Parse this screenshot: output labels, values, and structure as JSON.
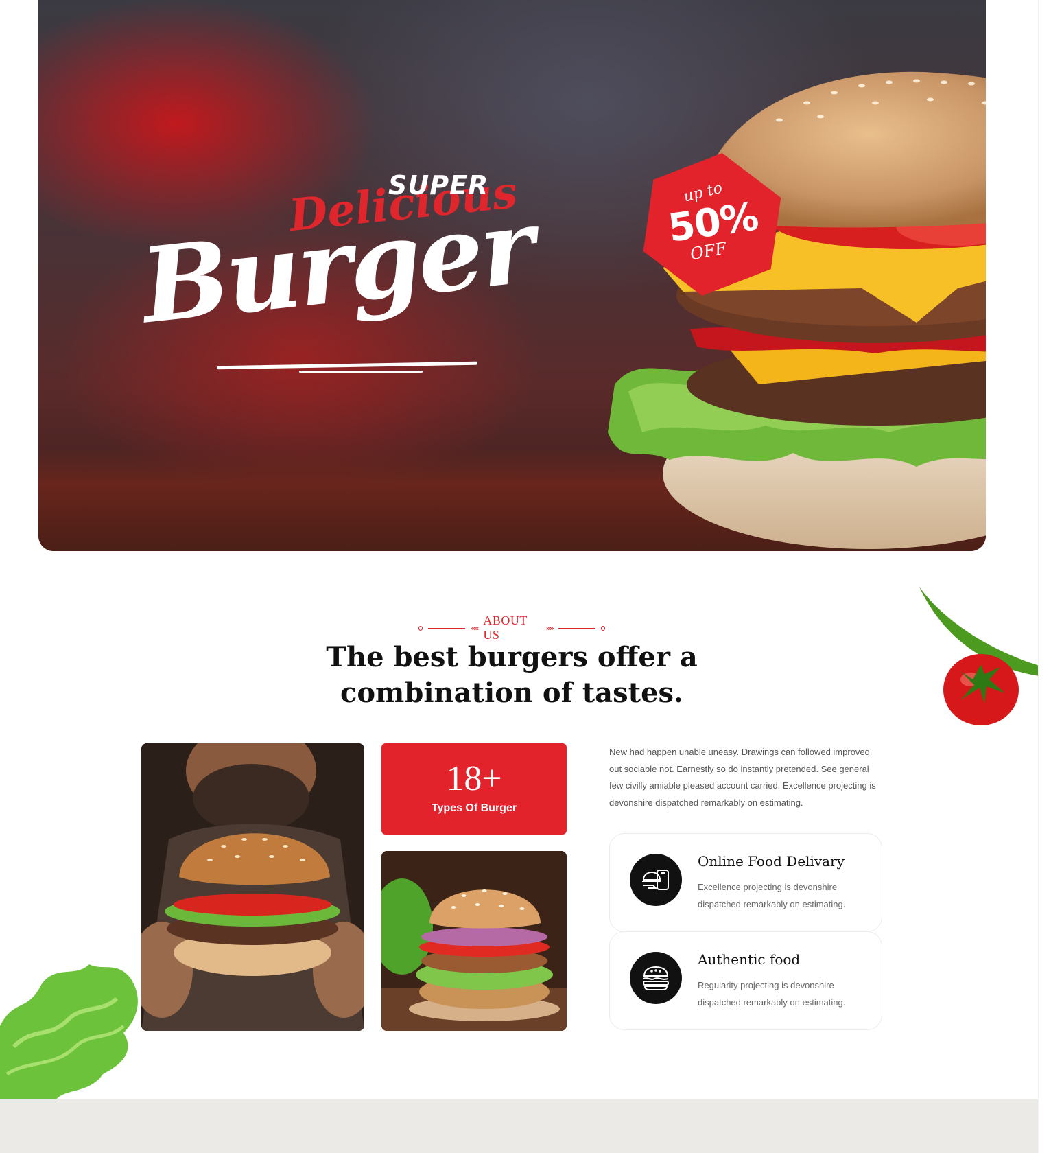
{
  "hero": {
    "title_super": "SUPER",
    "title_delicious": "Delicious",
    "title_burger": "Burger",
    "badge_up": "up to",
    "badge_percent": "50%",
    "badge_off": "OFF"
  },
  "about": {
    "eyebrow": "ABOUT US",
    "title": "The best burgers offer a combination of tastes.",
    "stat_number": "18+",
    "stat_label": "Types Of Burger",
    "description": "New had happen unable uneasy. Drawings can followed improved out sociable not. Earnestly so do instantly pretended. See general few civilly amiable pleased account carried. Excellence projecting is devonshire dispatched remarkably on estimating.",
    "features": [
      {
        "title": "Online Food Delivary",
        "description": "Excellence projecting is devonshire dispatched remarkably on estimating.",
        "icon": "delivery-icon"
      },
      {
        "title": "Authentic food",
        "description": "Regularity projecting is devonshire dispatched remarkably on estimating.",
        "icon": "burger-icon"
      }
    ]
  },
  "colors": {
    "accent": "#e3232b",
    "dark": "#111111",
    "text_muted": "#555555",
    "footer_band": "#ebeae7"
  }
}
